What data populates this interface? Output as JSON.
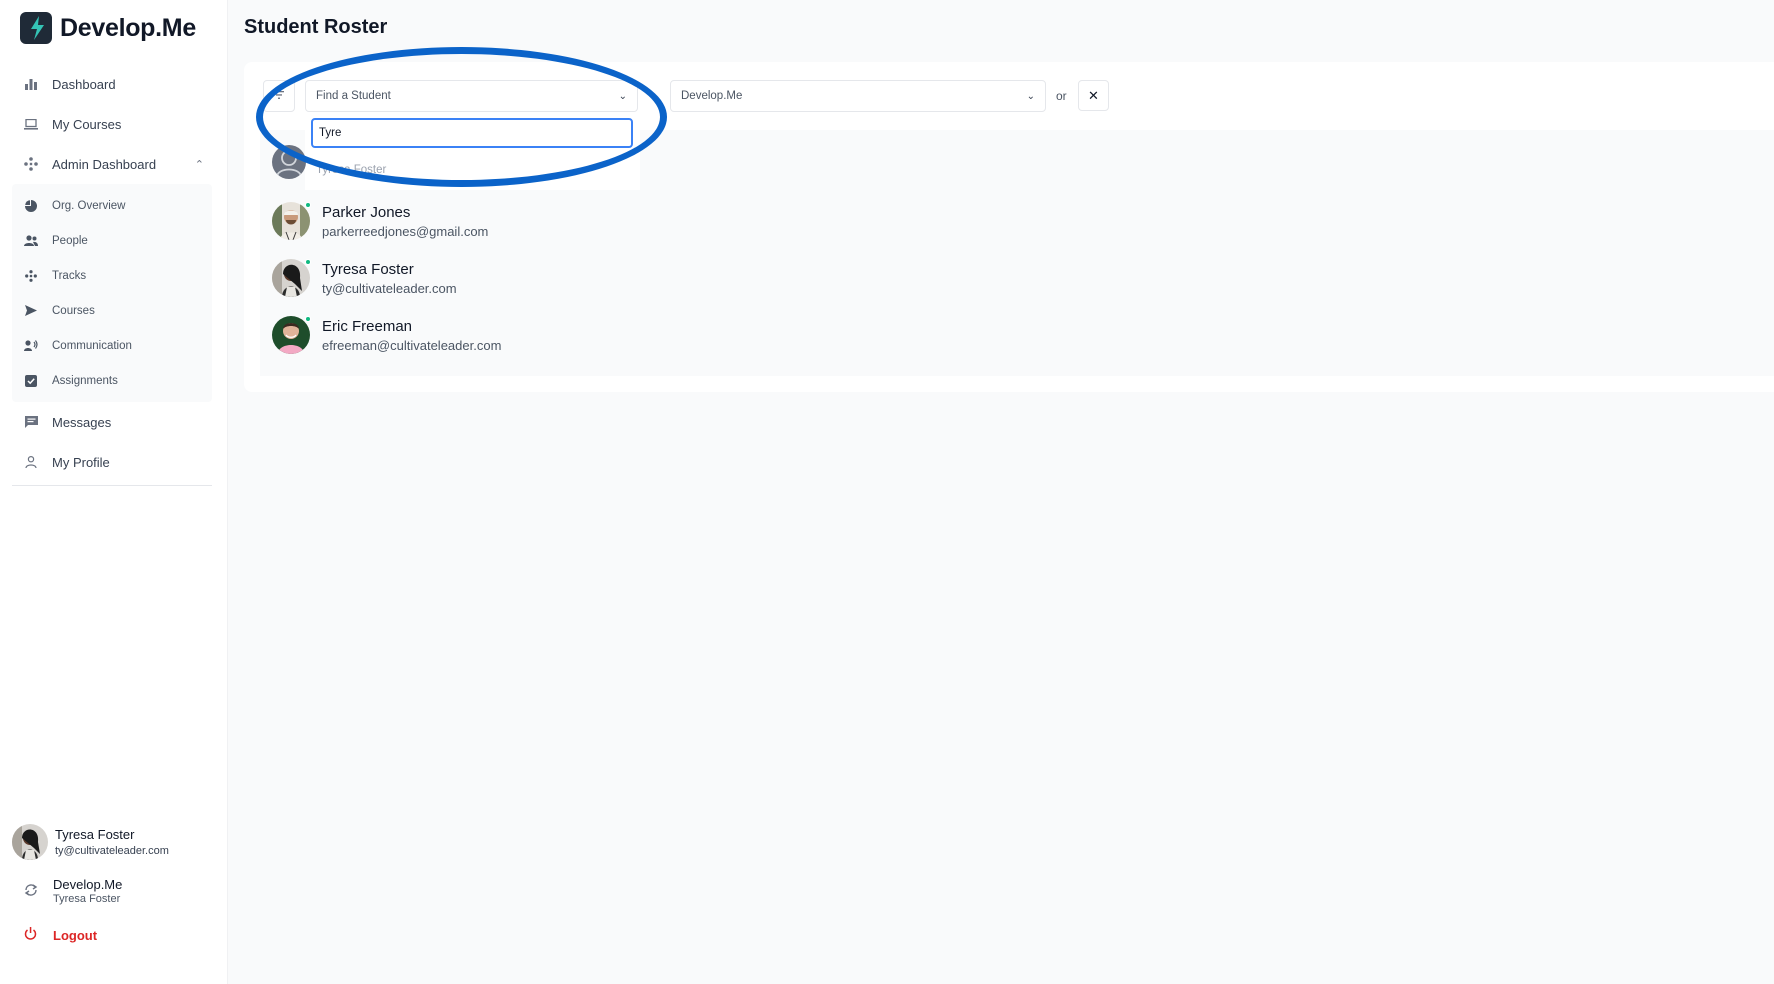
{
  "app": {
    "name": "Develop.Me"
  },
  "sidebar": {
    "items": [
      {
        "label": "Dashboard",
        "icon": "bar-chart-icon"
      },
      {
        "label": "My Courses",
        "icon": "laptop-icon"
      },
      {
        "label": "Admin Dashboard",
        "icon": "admin-icon"
      }
    ],
    "admin_items": [
      {
        "label": "Org. Overview",
        "icon": "pie-chart-icon"
      },
      {
        "label": "People",
        "icon": "people-icon"
      },
      {
        "label": "Tracks",
        "icon": "tracks-icon"
      },
      {
        "label": "Courses",
        "icon": "send-icon"
      },
      {
        "label": "Communication",
        "icon": "megaphone-icon"
      },
      {
        "label": "Assignments",
        "icon": "checkbox-icon"
      }
    ],
    "bottom_items": [
      {
        "label": "Messages",
        "icon": "message-icon"
      },
      {
        "label": "My Profile",
        "icon": "user-icon"
      }
    ],
    "user": {
      "name": "Tyresa Foster",
      "email": "ty@cultivateleader.com"
    },
    "org": {
      "name": "Develop.Me",
      "member": "Tyresa Foster"
    },
    "logout_label": "Logout"
  },
  "page": {
    "title": "Student Roster"
  },
  "filters": {
    "student_placeholder": "Find a Student",
    "org_value": "Develop.Me",
    "or_label": "or",
    "clear_label": "✕",
    "search_value": "Tyre",
    "dropdown_option": "Tyresa Foster"
  },
  "students": [
    {
      "name": "Parker Jones",
      "email": "parkerreedjones@gmail.com"
    },
    {
      "name": "Tyresa Foster",
      "email": "ty@cultivateleader.com"
    },
    {
      "name": "Eric Freeman",
      "email": "efreeman@cultivateleader.com"
    }
  ],
  "colors": {
    "accent": "#3b82f6",
    "annotation": "#0b63c9",
    "logout": "#dc2626",
    "online": "#10b981"
  }
}
